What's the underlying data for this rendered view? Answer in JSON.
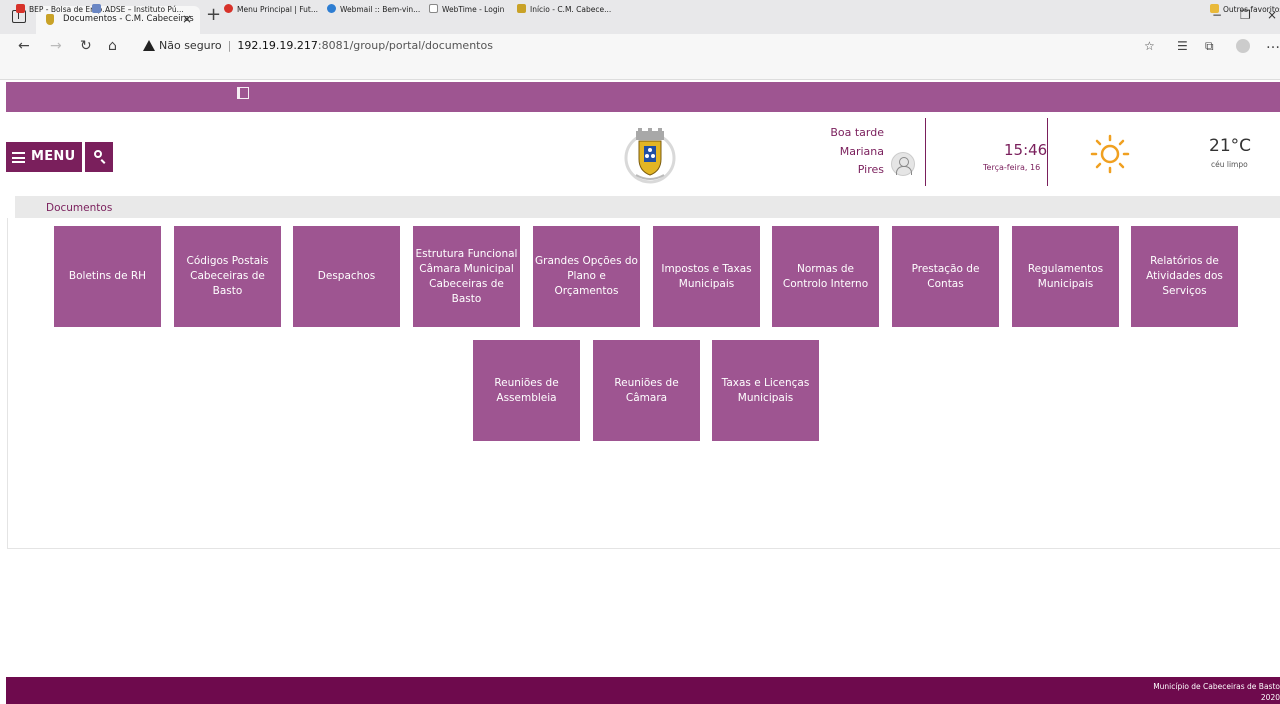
{
  "browser": {
    "tab_title": "Documentos - C.M. Cabeceiras",
    "tab_close": "×",
    "new_tab": "+",
    "window_controls": [
      "−",
      "❐",
      "×"
    ],
    "security_label": "Não seguro",
    "url_host": "192.19.19.217",
    "url_rest": ":8081/group/portal/documentos",
    "bookmarks": [
      {
        "label": "BEP - Bolsa de Emp...",
        "icon": "bep-icon",
        "color": "#d7322a"
      },
      {
        "label": "ADSE – Instituto Pú...",
        "icon": "adse-icon",
        "color": "#6a86c4"
      },
      {
        "label": "Menu Principal | Fut...",
        "icon": "futebol-icon",
        "color": "#d7322a"
      },
      {
        "label": "Webmail :: Bem-vin...",
        "icon": "webmail-icon",
        "color": "#2d7dd2"
      },
      {
        "label": "WebTime - Login",
        "icon": "page-icon",
        "color": "#888888"
      },
      {
        "label": "Início - C.M. Cabece...",
        "icon": "crest-icon",
        "color": "#c9a227"
      }
    ],
    "other_favorites": "Outros favoritos"
  },
  "header": {
    "menu_label": "MENU",
    "greeting": "Boa tarde",
    "user_first": "Mariana",
    "user_last": "Pires",
    "time": "15:46",
    "date": "Terça-feira, 16",
    "temperature": "21°C",
    "weather": "céu limpo"
  },
  "breadcrumb": "Documentos",
  "tiles": [
    "Boletins de RH",
    "Códigos Postais Cabeceiras de Basto",
    "Despachos",
    "Estrutura Funcional Câmara Municipal Cabeceiras de Basto",
    "Grandes Opções do Plano e Orçamentos",
    "Impostos e Taxas Municipais",
    "Normas de Controlo Interno",
    "Prestação de Contas",
    "Regulamentos Municipais",
    "Relatórios de Atividades dos Serviços",
    "Reuniões de Assembleia",
    "Reuniões de Câmara",
    "Taxas e Licenças Municipais"
  ],
  "footer": {
    "text": "Município de Cabeceiras de Basto",
    "year": "2020"
  },
  "colors": {
    "tile": "#9e5591",
    "brand_dark": "#7a1f5c",
    "footer": "#6e0a4d"
  }
}
